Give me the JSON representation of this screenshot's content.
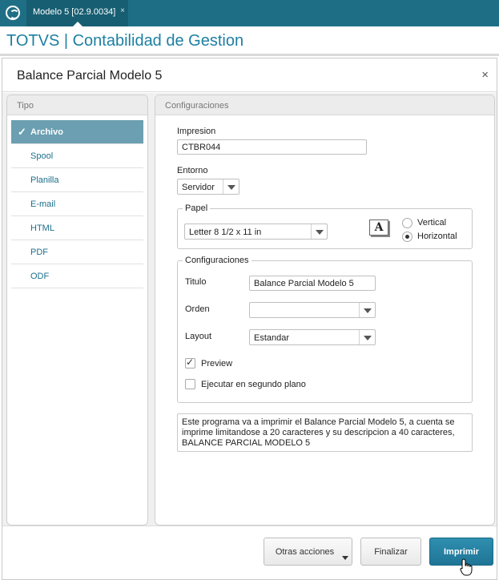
{
  "topbar": {
    "tab_label": "Modelo 5 [02.9.0034]",
    "close_glyph": "×",
    "accent": "#1e6f86"
  },
  "app": {
    "title": "TOTVS | Contabilidad de Gestion"
  },
  "modal": {
    "title": "Balance Parcial Modelo 5",
    "close_glyph": "×"
  },
  "tipo": {
    "header": "Tipo",
    "items": [
      {
        "label": "Archivo",
        "selected": true
      },
      {
        "label": "Spool"
      },
      {
        "label": "Planilla"
      },
      {
        "label": "E-mail"
      },
      {
        "label": "HTML"
      },
      {
        "label": "PDF"
      },
      {
        "label": "ODF"
      }
    ]
  },
  "config": {
    "header": "Configuraciones",
    "impresion": {
      "label": "Impresion",
      "value": "CTBR044"
    },
    "entorno": {
      "label": "Entorno",
      "value": "Servidor"
    },
    "papel": {
      "legend": "Papel",
      "value": "Letter 8 1/2 x 11 in",
      "icon_glyph": "A",
      "orientation": [
        {
          "label": "Vertical",
          "selected": false
        },
        {
          "label": "Horizontal",
          "selected": true
        }
      ]
    },
    "opciones": {
      "legend": "Configuraciones",
      "titulo": {
        "label": "Titulo",
        "value": "Balance Parcial Modelo 5"
      },
      "orden": {
        "label": "Orden",
        "value": ""
      },
      "layout": {
        "label": "Layout",
        "value": "Estandar"
      },
      "preview": {
        "label": "Preview",
        "checked": true
      },
      "segundo_plano": {
        "label": "Ejecutar en segundo plano",
        "checked": false
      }
    },
    "description": "Este programa va a imprimir el Balance Parcial Modelo 5, a cuenta se imprime limitandose a 20 caracteres y su descripcion a 40 caracteres, BALANCE PARCIAL MODELO 5"
  },
  "footer": {
    "otras_acciones": "Otras acciones",
    "finalizar": "Finalizar",
    "imprimir": "Imprimir"
  }
}
